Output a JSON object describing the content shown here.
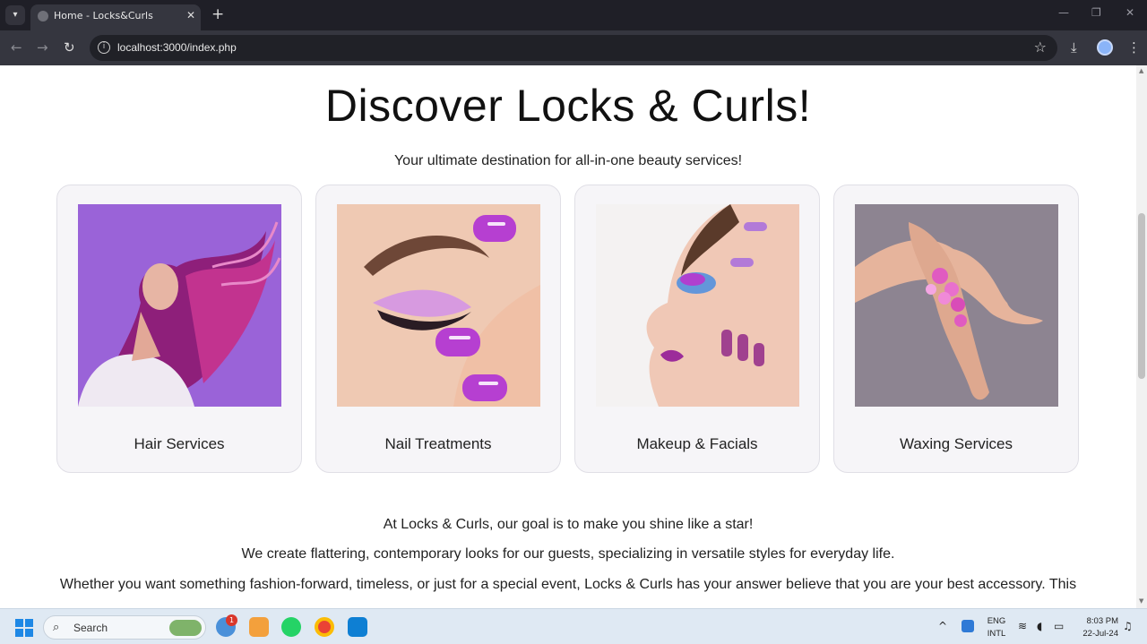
{
  "browser": {
    "tab_title": "Home - Locks&Curls",
    "tab_close": "✕",
    "new_tab": "+",
    "url": "localhost:3000/index.php"
  },
  "hero": {
    "title": "Discover Locks & Curls!",
    "subtitle": "Your ultimate destination for all-in-one beauty services!"
  },
  "services": [
    {
      "label": "Hair Services"
    },
    {
      "label": "Nail Treatments"
    },
    {
      "label": "Makeup & Facials"
    },
    {
      "label": "Waxing Services"
    }
  ],
  "about": {
    "line1": "At Locks & Curls, our goal is to make you shine like a star!",
    "line2": "We create flattering, contemporary looks for our guests, specializing in versatile styles for everyday life.",
    "line3": "Whether you want something fashion-forward, timeless, or just for a special event, Locks & Curls has your answer believe that you are your best accessory. This"
  },
  "taskbar": {
    "search_label": "Search",
    "notification_count": "1",
    "lang_top": "ENG",
    "lang_bottom": "INTL",
    "time": "8:03 PM",
    "date": "22-Jul-24"
  },
  "colors": {
    "accent_purple": "#b03fcf",
    "card_bg": "#f6f5f8",
    "taskbar_bg": "#dfe9f3"
  }
}
